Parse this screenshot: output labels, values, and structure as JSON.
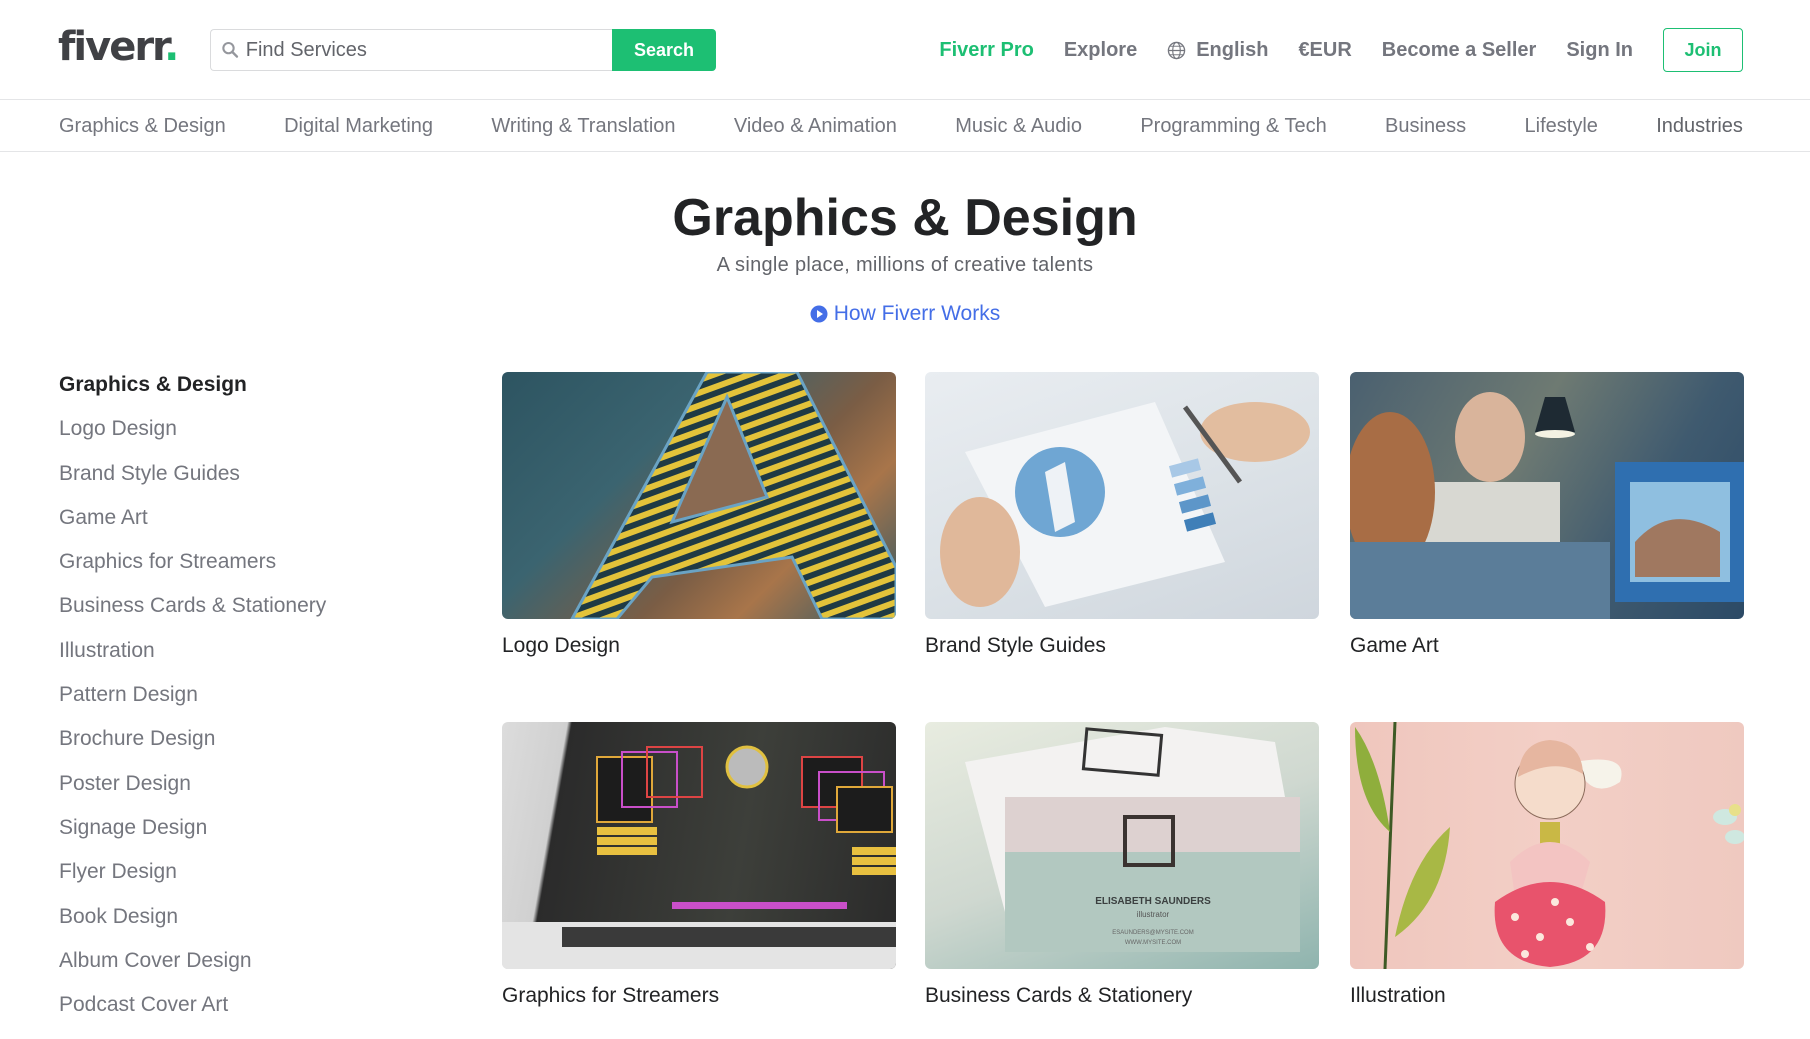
{
  "header": {
    "logo_text": "fiverr",
    "logo_dot": ".",
    "search": {
      "placeholder": "Find Services",
      "value": "",
      "button_label": "Search"
    },
    "links": {
      "fiverr_pro": "Fiverr Pro",
      "explore": "Explore",
      "language": "English",
      "currency": "€EUR",
      "become_seller": "Become a Seller",
      "sign_in": "Sign In",
      "join": "Join"
    }
  },
  "category_nav": [
    "Graphics & Design",
    "Digital Marketing",
    "Writing & Translation",
    "Video & Animation",
    "Music & Audio",
    "Programming & Tech",
    "Business",
    "Lifestyle",
    "Industries"
  ],
  "hero": {
    "title": "Graphics & Design",
    "subtitle": "A single place, millions of creative talents",
    "how_link": "How Fiverr Works"
  },
  "sidebar": {
    "heading": "Graphics & Design",
    "items": [
      "Logo Design",
      "Brand Style Guides",
      "Game Art",
      "Graphics for Streamers",
      "Business Cards & Stationery",
      "Illustration",
      "Pattern Design",
      "Brochure Design",
      "Poster Design",
      "Signage Design",
      "Flyer Design",
      "Book Design",
      "Album Cover Design",
      "Podcast Cover Art"
    ]
  },
  "cards": [
    {
      "label": "Logo Design",
      "image": "logo-design-image"
    },
    {
      "label": "Brand Style Guides",
      "image": "brand-style-guides-image"
    },
    {
      "label": "Game Art",
      "image": "game-art-image"
    },
    {
      "label": "Graphics for Streamers",
      "image": "graphics-for-streamers-image"
    },
    {
      "label": "Business Cards & Stationery",
      "image": "business-cards-image",
      "card_text": {
        "name": "ELISABETH SAUNDERS",
        "role": "illustrator",
        "email": "ESAUNDERS@MYSITE.COM",
        "site": "WWW.MYSITE.COM"
      }
    },
    {
      "label": "Illustration",
      "image": "illustration-image"
    }
  ],
  "colors": {
    "brand_green": "#1dbf73",
    "link_blue": "#446ee7",
    "text_dark": "#222325",
    "text_muted": "#74767e"
  }
}
